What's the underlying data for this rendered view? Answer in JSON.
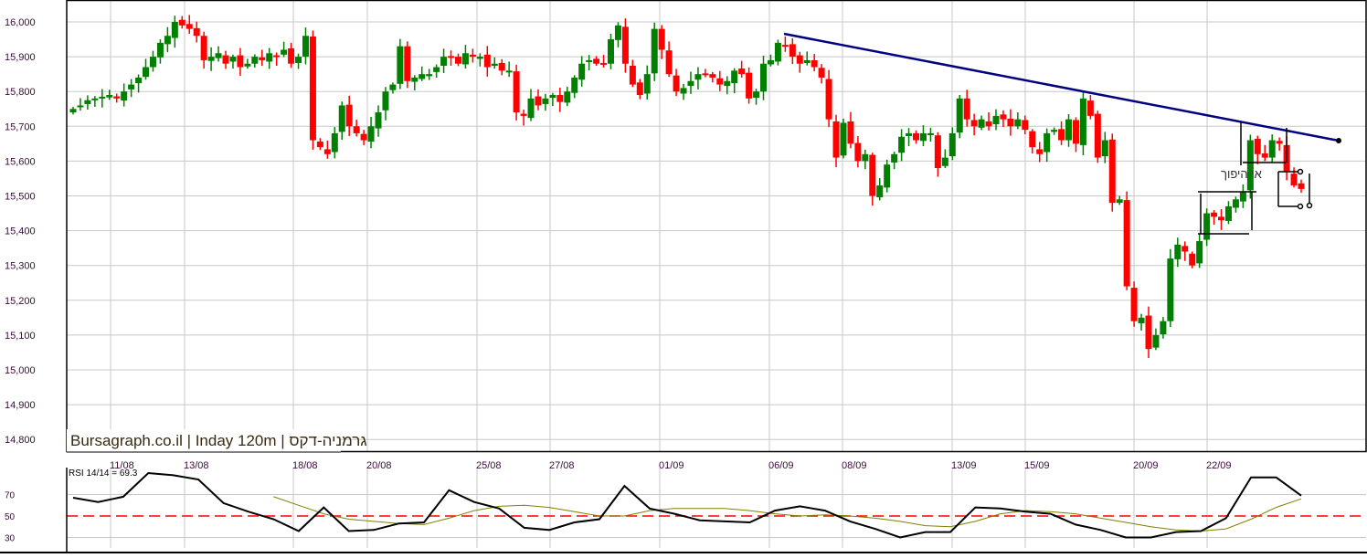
{
  "chart_data": {
    "type": "candlestick",
    "title": "Bursagraph.co.il | Inday 120m | גרמניה-דקס",
    "y_ticks": [
      "16,000",
      "15,900",
      "15,800",
      "15,700",
      "15,600",
      "15,500",
      "15,400",
      "15,300",
      "15,200",
      "15,100",
      "15,000",
      "14,900",
      "14,800"
    ],
    "ylim": [
      14780,
      16060
    ],
    "x_ticks": [
      "11/08",
      "13/08",
      "18/08",
      "20/08",
      "25/08",
      "27/08",
      "01/09",
      "06/09",
      "08/09",
      "13/09",
      "15/09",
      "20/09",
      "22/09"
    ],
    "closes": [
      15750,
      15760,
      15775,
      15780,
      15785,
      15790,
      15780,
      15800,
      15820,
      15840,
      15870,
      15900,
      15940,
      15960,
      16000,
      15990,
      15980,
      15960,
      15890,
      15900,
      15910,
      15880,
      15900,
      15870,
      15880,
      15900,
      15890,
      15910,
      15900,
      15920,
      15880,
      15900,
      15960,
      15660,
      15640,
      15620,
      15680,
      15760,
      15700,
      15680,
      15660,
      15700,
      15740,
      15800,
      15820,
      15930,
      15830,
      15840,
      15850,
      15850,
      15870,
      15900,
      15900,
      15880,
      15910,
      15900,
      15900,
      15870,
      15880,
      15860,
      15860,
      15740,
      15730,
      15780,
      15760,
      15780,
      15790,
      15770,
      15800,
      15840,
      15880,
      15890,
      15880,
      15880,
      15950,
      15990,
      15880,
      15820,
      15790,
      15850,
      15980,
      15920,
      15850,
      15800,
      15810,
      15830,
      15850,
      15850,
      15840,
      15820,
      15830,
      15860,
      15850,
      15780,
      15800,
      15880,
      15890,
      15940,
      15930,
      15900,
      15880,
      15890,
      15870,
      15840,
      15720,
      15610,
      15710,
      15650,
      15600,
      15620,
      15500,
      15530,
      15590,
      15620,
      15670,
      15680,
      15660,
      15680,
      15680,
      15580,
      15610,
      15680,
      15780,
      15720,
      15700,
      15720,
      15700,
      15730,
      15720,
      15700,
      15720,
      15690,
      15640,
      15620,
      15680,
      15690,
      15660,
      15720,
      15650,
      15780,
      15730,
      15610,
      15660,
      15480,
      15490,
      15240,
      15140,
      15150,
      15060,
      15100,
      15140,
      15320,
      15360,
      15340,
      15300,
      15370,
      15450,
      15440,
      15430,
      15470,
      15490,
      15510,
      15660,
      15620,
      15610,
      15660,
      15650,
      15570,
      15530,
      15520
    ],
    "up_color": "#008000",
    "down_color": "#ff0000",
    "trendline_color": "#000080",
    "annotation": "אי היפוך",
    "rsi": {
      "label": "RSI 14/14 = 69.3",
      "levels": [
        "70",
        "50",
        "30"
      ],
      "ylim": [
        20,
        100
      ],
      "values": [
        67,
        63,
        68,
        90,
        88,
        84,
        62,
        54,
        47,
        36,
        58,
        36,
        37,
        43,
        44,
        74,
        63,
        57,
        39,
        37,
        44,
        47,
        78,
        57,
        52,
        46,
        45,
        44,
        55,
        59,
        55,
        45,
        38,
        30,
        35,
        35,
        58,
        57,
        54,
        52,
        42,
        37,
        30,
        30,
        35,
        36,
        48,
        86,
        86,
        69
      ],
      "signal": [
        null,
        null,
        null,
        null,
        null,
        null,
        null,
        null,
        68,
        60,
        52,
        47,
        45,
        43,
        42,
        48,
        55,
        59,
        60,
        58,
        54,
        50,
        50,
        55,
        57,
        57,
        57,
        55,
        52,
        50,
        51,
        50,
        48,
        45,
        41,
        40,
        45,
        52,
        55,
        54,
        52,
        48,
        44,
        40,
        37,
        36,
        38,
        47,
        58,
        66
      ],
      "line_color": "#000000",
      "signal_color": "#808000",
      "midline_color": "#ff0000"
    }
  }
}
